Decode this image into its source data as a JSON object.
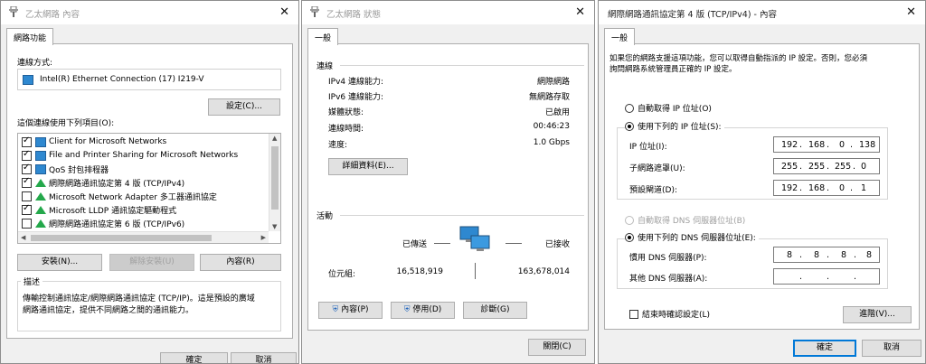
{
  "w1": {
    "title": "乙太網路 內容",
    "tab": "網路功能",
    "connect_using_label": "連線方式:",
    "adapter": "Intel(R) Ethernet Connection (17) I219-V",
    "configure_btn": "設定(C)...",
    "items_label": "這個連線使用下列項目(O):",
    "items": [
      {
        "label": "Client for Microsoft Networks",
        "checked": true,
        "icon": "network-client-icon"
      },
      {
        "label": "File and Printer Sharing for Microsoft Networks",
        "checked": true,
        "icon": "network-client-icon"
      },
      {
        "label": "QoS 封包排程器",
        "checked": true,
        "icon": "network-client-icon"
      },
      {
        "label": "網際網路通訊協定第 4 版 (TCP/IPv4)",
        "checked": true,
        "icon": "protocol-icon"
      },
      {
        "label": "Microsoft Network Adapter 多工器通訊協定",
        "checked": false,
        "icon": "protocol-icon"
      },
      {
        "label": "Microsoft LLDP 通訊協定驅動程式",
        "checked": true,
        "icon": "protocol-icon"
      },
      {
        "label": "網際網路通訊協定第 6 版 (TCP/IPv6)",
        "checked": false,
        "icon": "protocol-icon"
      }
    ],
    "install_btn": "安裝(N)...",
    "uninstall_btn": "解除安裝(U)",
    "properties_btn": "內容(R)",
    "description_label": "描述",
    "description_text_1": "傳輸控制通訊協定/網際網路通訊協定 (TCP/IP)。這是預設的廣域",
    "description_text_2": "網路通訊協定，提供不同網路之間的通訊能力。",
    "ok_btn": "確定",
    "cancel_btn": "取消"
  },
  "w2": {
    "title": "乙太網路 狀態",
    "tab": "一般",
    "connection_label": "連線",
    "rows": [
      {
        "label": "IPv4 連線能力:",
        "value": "網際網路"
      },
      {
        "label": "IPv6 連線能力:",
        "value": "無網路存取"
      },
      {
        "label": "媒體狀態:",
        "value": "已啟用"
      },
      {
        "label": "連線時間:",
        "value": "00:46:23"
      },
      {
        "label": "速度:",
        "value": "1.0 Gbps"
      }
    ],
    "details_btn": "詳細資料(E)...",
    "activity_label": "活動",
    "sent_label": "已傳送",
    "received_label": "已接收",
    "bytes_label": "位元組:",
    "bytes_sent": "16,518,919",
    "bytes_received": "163,678,014",
    "properties_btn": "內容(P)",
    "disable_btn": "停用(D)",
    "diagnose_btn": "診斷(G)",
    "close_btn": "關閉(C)"
  },
  "w3": {
    "title": "網際網路通訊協定第 4 版 (TCP/IPv4) - 內容",
    "tab": "一般",
    "intro_1": "如果您的網路支援這項功能，您可以取得自動指派的 IP 設定。否則，您必須",
    "intro_2": "詢問網路系統管理員正確的 IP 設定。",
    "auto_ip": "自動取得 IP 位址(O)",
    "use_ip": "使用下列的 IP 位址(S):",
    "ip_label": "IP 位址(I):",
    "ip": [
      "192",
      "168",
      "0",
      "138"
    ],
    "mask_label": "子網路遮罩(U):",
    "mask": [
      "255",
      "255",
      "255",
      "0"
    ],
    "gateway_label": "預設閘道(D):",
    "gateway": [
      "192",
      "168",
      "0",
      "1"
    ],
    "auto_dns": "自動取得 DNS 伺服器位址(B)",
    "use_dns": "使用下列的 DNS 伺服器位址(E):",
    "pref_dns_label": "慣用 DNS 伺服器(P):",
    "pref_dns": [
      "8",
      "8",
      "8",
      "8"
    ],
    "alt_dns_label": "其他 DNS 伺服器(A):",
    "validate_label": "結束時確認設定(L)",
    "advanced_btn": "進階(V)...",
    "ok_btn": "確定",
    "cancel_btn": "取消"
  }
}
